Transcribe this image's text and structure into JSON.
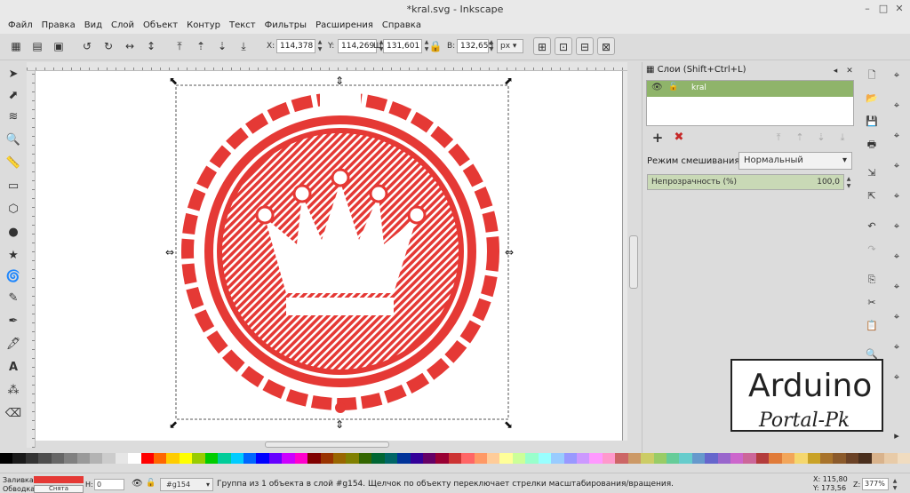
{
  "window": {
    "title": "*kral.svg - Inkscape"
  },
  "menu": [
    "Файл",
    "Правка",
    "Вид",
    "Слой",
    "Объект",
    "Контур",
    "Текст",
    "Фильтры",
    "Расширения",
    "Справка"
  ],
  "toolbar": {
    "x_label": "X:",
    "x_value": "114,378",
    "y_label": "Y:",
    "y_value": "114,269",
    "w_label": "Ш:",
    "w_value": "131,601",
    "h_label": "В:",
    "h_value": "132,655",
    "unit": "px"
  },
  "layers_panel": {
    "title": "Слои (Shift+Ctrl+L)",
    "layer_name": "kral",
    "blend_label": "Режим смешивания:",
    "blend_value": "Нормальный",
    "opacity_label": "Непрозрачность (%)",
    "opacity_value": "100,0"
  },
  "status": {
    "fill_label": "Заливка:",
    "stroke_label": "Обводка:",
    "stroke_value": "Снята",
    "h_label": "Н:",
    "h_value": "0",
    "layer_value": "#g154",
    "message": "Группа из 1 объекта в слой #g154. Щелчок по объекту переключает стрелки масштабирования/вращения.",
    "x_readout": "X: 115,80",
    "y_readout": "Y: 173,56",
    "zoom_label": "Z:",
    "zoom_value": "377%"
  },
  "watermark": {
    "line1": "Arduino",
    "line2": "Portal-Pk"
  },
  "colors": {
    "accent_red": "#e53935",
    "layer_selected": "#8fb46a",
    "palette": [
      "#000000",
      "#1a1a1a",
      "#333333",
      "#4d4d4d",
      "#666666",
      "#808080",
      "#999999",
      "#b3b3b3",
      "#cccccc",
      "#e6e6e6",
      "#ffffff",
      "#ff0000",
      "#ff6600",
      "#ffcc00",
      "#ffff00",
      "#99cc00",
      "#00cc00",
      "#00cc99",
      "#00ccff",
      "#0066ff",
      "#0000ff",
      "#6600ff",
      "#cc00ff",
      "#ff00cc",
      "#800000",
      "#993300",
      "#996600",
      "#808000",
      "#336600",
      "#006633",
      "#006666",
      "#003399",
      "#330099",
      "#660066",
      "#990033",
      "#cc3333",
      "#ff6666",
      "#ff9966",
      "#ffcc99",
      "#ffff99",
      "#ccff99",
      "#99ffcc",
      "#99ffff",
      "#99ccff",
      "#9999ff",
      "#cc99ff",
      "#ff99ff",
      "#ff99cc",
      "#cc6666",
      "#cc9966",
      "#cccc66",
      "#99cc66",
      "#66cc99",
      "#66cccc",
      "#6699cc",
      "#6666cc",
      "#9966cc",
      "#cc66cc",
      "#cc6699",
      "#b33c3c",
      "#e07b39",
      "#f2a65a",
      "#f5d76e",
      "#c9a227",
      "#a8732b",
      "#8b5a2b",
      "#6b4226",
      "#4a2f1d",
      "#d9b38c",
      "#e8cba8",
      "#f0dcc0"
    ]
  }
}
